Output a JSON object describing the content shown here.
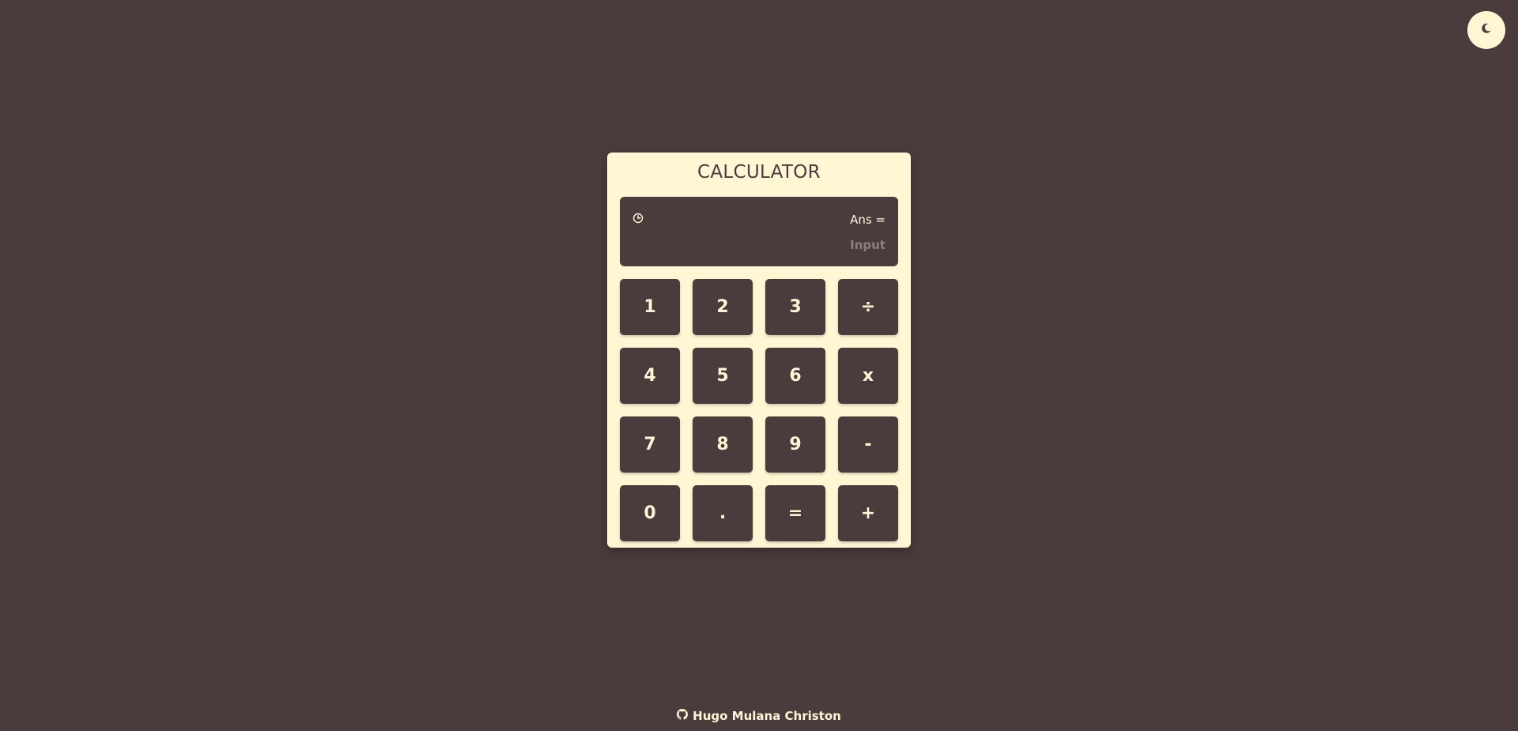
{
  "theme_toggle": {
    "icon": "moon-icon"
  },
  "calculator": {
    "title": "CALCULATOR",
    "display": {
      "history_icon": "history-clock-icon",
      "ans_label": "Ans =",
      "input_placeholder": "Input"
    },
    "keys": [
      "1",
      "2",
      "3",
      "÷",
      "4",
      "5",
      "6",
      "x",
      "7",
      "8",
      "9",
      "-",
      "0",
      ".",
      "=",
      "+"
    ]
  },
  "footer": {
    "icon": "github-icon",
    "author": "Hugo Mulana Christon"
  },
  "colors": {
    "background": "#4a3c3d",
    "surface": "#fff7d4",
    "muted_text": "#8a7f7a"
  }
}
